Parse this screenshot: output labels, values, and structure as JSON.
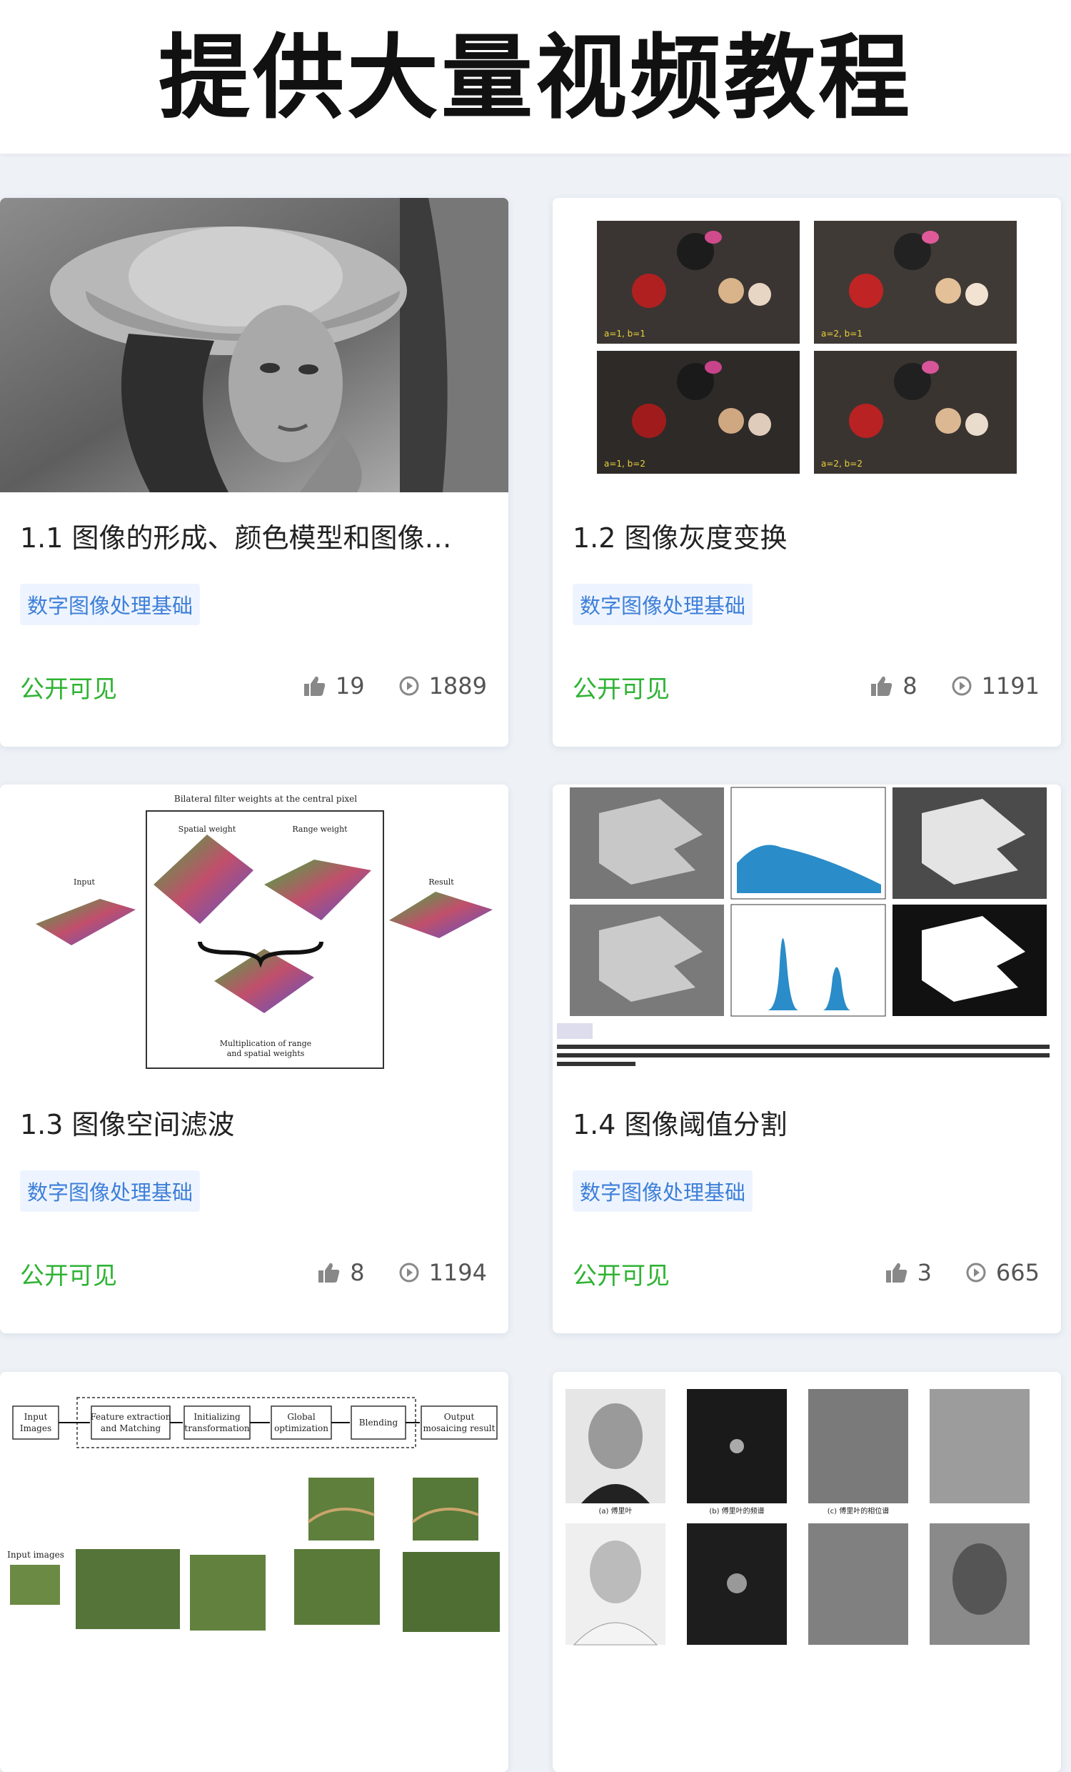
{
  "banner": {
    "title": "提供大量视频教程"
  },
  "cards": [
    {
      "title": "1.1 图像的形成、颜色模型和图像…",
      "tag": "数字图像处理基础",
      "visibility": "公开可见",
      "likes": "19",
      "views": "1889"
    },
    {
      "title": "1.2 图像灰度变换",
      "tag": "数字图像处理基础",
      "visibility": "公开可见",
      "likes": "8",
      "views": "1191",
      "thumb_labels": [
        "a=1, b=1",
        "a=2, b=1",
        "a=1, b=2",
        "a=2, b=2"
      ]
    },
    {
      "title": "1.3 图像空间滤波",
      "tag": "数字图像处理基础",
      "visibility": "公开可见",
      "likes": "8",
      "views": "1194",
      "thumb_labels": [
        "Bilateral filter weights at the central pixel",
        "Spatial weight",
        "Range weight",
        "Input",
        "Result",
        "Multiplication of range",
        "and spatial weights"
      ]
    },
    {
      "title": "1.4 图像阈值分割",
      "tag": "数字图像处理基础",
      "visibility": "公开可见",
      "likes": "3",
      "views": "665"
    },
    {
      "thumb_labels": [
        "Input",
        "Images",
        "Feature extraction",
        "and Matching",
        "Initializing",
        "transformation",
        "Global",
        "optimization",
        "Blending",
        "Output",
        "mosaicing result",
        "Input images"
      ]
    },
    {
      "thumb_labels": [
        "(a) 傅里叶",
        "(b) 傅里叶的频谱",
        "(c) 傅里叶的相位谱"
      ]
    }
  ],
  "colors": {
    "tag_text": "#3d7fd8",
    "tag_bg": "#eef4ff",
    "visibility": "#2fb334",
    "page_bg": "#eef2f7"
  },
  "icons": {
    "like": "thumbs-up-icon",
    "views": "play-circle-icon"
  }
}
